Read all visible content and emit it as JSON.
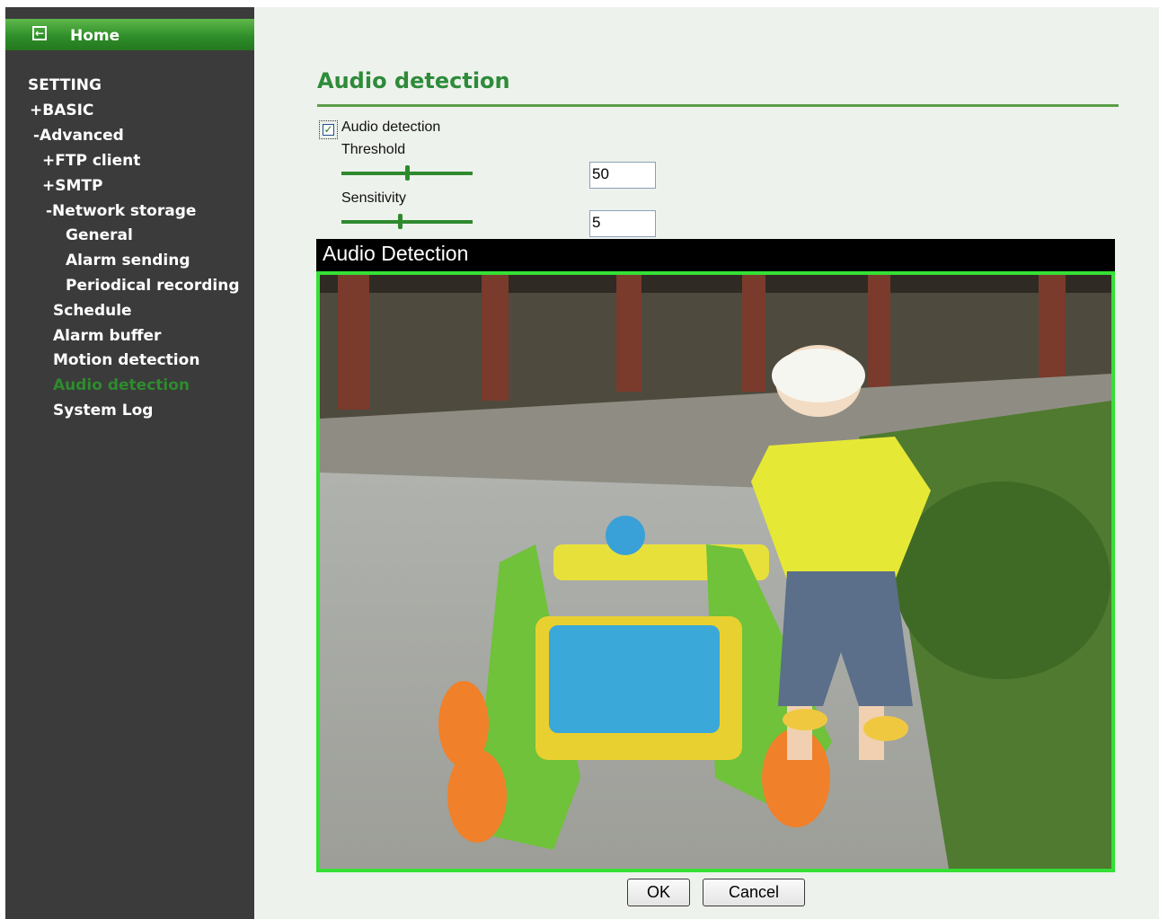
{
  "sidebar": {
    "home_label": "Home",
    "items": [
      {
        "label": "SETTING"
      },
      {
        "label": "+BASIC"
      },
      {
        "label": "-Advanced"
      },
      {
        "label": "+FTP client"
      },
      {
        "label": "+SMTP"
      },
      {
        "label": "-Network storage"
      },
      {
        "label": "General"
      },
      {
        "label": "Alarm sending"
      },
      {
        "label": "Periodical recording"
      },
      {
        "label": "Schedule"
      },
      {
        "label": "Alarm buffer"
      },
      {
        "label": "Motion detection"
      },
      {
        "label": "Audio detection",
        "active": true
      },
      {
        "label": "System Log"
      }
    ]
  },
  "main": {
    "title": "Audio detection",
    "enable": {
      "label": "Audio detection",
      "checked": true
    },
    "threshold": {
      "label": "Threshold",
      "value": "50",
      "level": 0.5
    },
    "sensitivity": {
      "label": "Sensitivity",
      "value": "5",
      "level": 0.45
    },
    "video": {
      "title": "Audio Detection"
    },
    "buttons": {
      "ok": "OK",
      "cancel": "Cancel"
    }
  },
  "colors": {
    "sidebar_bg": "#3b3b3b",
    "accent_green": "#2e8b3a",
    "active_item": "#2e8b2e",
    "video_border": "#35e035",
    "content_bg": "#eef2ec"
  }
}
